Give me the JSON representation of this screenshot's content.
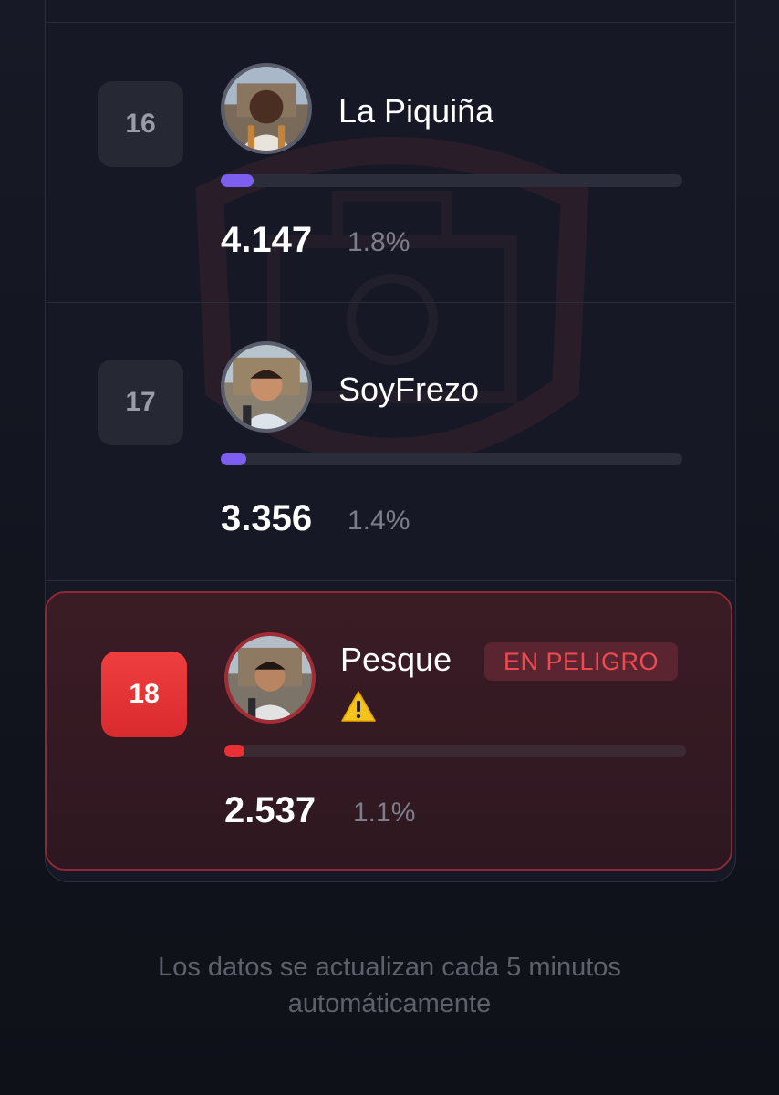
{
  "entries": [
    {
      "rank": "16",
      "name": "La Piquiña",
      "votes": "4.147",
      "percent": "1.8%",
      "share": 0.018
    },
    {
      "rank": "17",
      "name": "SoyFrezo",
      "votes": "3.356",
      "percent": "1.4%",
      "share": 0.014
    },
    {
      "rank": "18",
      "name": "Pesque",
      "votes": "2.537",
      "percent": "1.1%",
      "share": 0.011,
      "badge": "EN PELIGRO",
      "warning_icon": "warning-icon"
    }
  ],
  "footer": {
    "line1": "Los datos se actualizan cada 5 minutos",
    "line2": "automáticamente"
  },
  "colors": {
    "accent": "#7c5ef0",
    "danger": "#ea2f35",
    "background": "#12141e"
  }
}
